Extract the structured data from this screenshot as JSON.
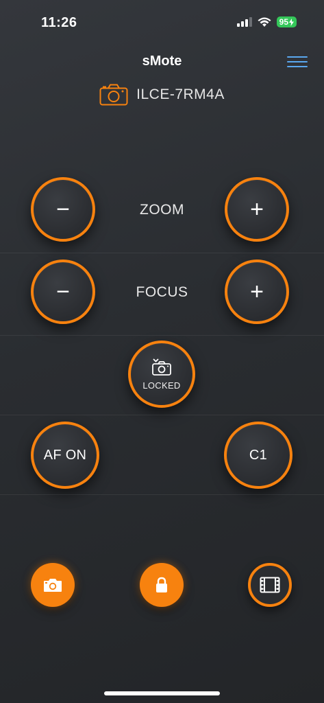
{
  "status_bar": {
    "time": "11:26",
    "battery": "95"
  },
  "header": {
    "title": "sMote",
    "device_name": "ILCE-7RM4A"
  },
  "controls": {
    "zoom": {
      "label": "ZOOM",
      "minus": "−",
      "plus": "+"
    },
    "focus": {
      "label": "FOCUS",
      "minus": "−",
      "plus": "+"
    },
    "lock": {
      "label": "LOCKED"
    },
    "af_on": {
      "label": "AF ON"
    },
    "custom": {
      "label": "C1"
    }
  },
  "modes": [
    {
      "name": "photo",
      "icon": "camera-icon",
      "active": true
    },
    {
      "name": "lock",
      "icon": "lock-icon",
      "active": true
    },
    {
      "name": "video",
      "icon": "film-icon",
      "active": false
    }
  ],
  "colors": {
    "accent": "#f7820f",
    "header_icon": "#5aa8f0",
    "background": "#2a2d31",
    "battery": "#34c759"
  }
}
